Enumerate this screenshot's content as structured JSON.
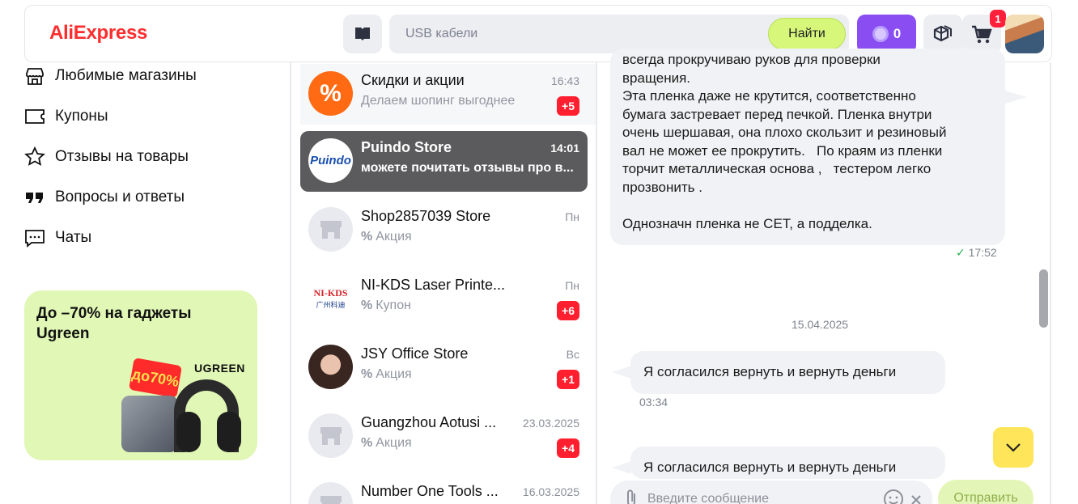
{
  "header": {
    "logo": "AliExpress",
    "search_placeholder": "USB кабели",
    "search_button": "Найти",
    "coins": "0",
    "cart_count": "1"
  },
  "menu": {
    "items": [
      {
        "label": "Любимые магазины",
        "icon": "store-icon"
      },
      {
        "label": "Купоны",
        "icon": "coupon-icon"
      },
      {
        "label": "Отзывы на товары",
        "icon": "star-icon"
      },
      {
        "label": "Вопросы и ответы",
        "icon": "quote-icon"
      },
      {
        "label": "Чаты",
        "icon": "chat-icon"
      }
    ]
  },
  "promo": {
    "title": "До –70% на гаджеты Ugreen",
    "tag": "до70%",
    "brand": "UGREEN"
  },
  "chats": [
    {
      "name": "Скидки и акции",
      "time": "16:43",
      "preview": "Делаем шопинг выгоднее",
      "badge": "+5"
    },
    {
      "name": "Puindo Store",
      "time": "14:01",
      "preview": "можете почитать отзывы про в...",
      "badge": ""
    },
    {
      "name": "Shop2857039 Store",
      "time": "Пн",
      "preview": "Акция",
      "badge": ""
    },
    {
      "name": "NI-KDS Laser Printe...",
      "time": "Пн",
      "preview": "Купон",
      "badge": "+6"
    },
    {
      "name": "JSY Office Store",
      "time": "Вс",
      "preview": "Акция",
      "badge": "+1"
    },
    {
      "name": "Guangzhou Aotusi ...",
      "time": "23.03.2025",
      "preview": "Акция",
      "badge": "+4"
    },
    {
      "name": "Number One Tools ...",
      "time": "16.03.2025",
      "preview": "",
      "badge": ""
    }
  ],
  "chat_logos": {
    "puindo": "Puindo",
    "nikds_top": "NI-KDS",
    "nikds_bottom": "广州科迪"
  },
  "conversation": {
    "message1_lines": [
      "всегда прокручиваю руков для проверки",
      "вращения.",
      "Эта пленка даже не крутится, соответственно",
      "бумага застревает перед печкой. Пленка внутри",
      "очень шершавая, она плохо скользит и резиновый",
      "вал не может ее прокрутить.   По краям из пленки",
      "торчит металлическая основа ,   тестером легко",
      "прозвонить .",
      "",
      "Однозначн пленка не CET, а подделка."
    ],
    "message1_time": "17:52",
    "date_separator": "15.04.2025",
    "message2": "Я согласился вернуть и вернуть деньги",
    "message2_time": "03:34",
    "message3": "Я согласился вернуть и вернуть деньги",
    "input_placeholder": "Введите сообщение",
    "send_button": "Отправить"
  },
  "colors": {
    "brand_red": "#ff2e2e",
    "search_green": "#d6f77a",
    "coins_purple": "#8a4df2",
    "badge_red": "#ff1f2e",
    "active_chat": "#5b5b5d",
    "scroll_button": "#ffe55a"
  }
}
